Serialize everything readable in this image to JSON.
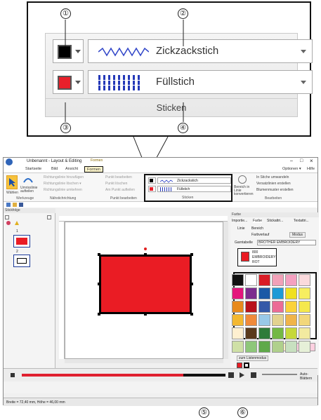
{
  "callouts": {
    "c1": "①",
    "c2": "②",
    "c3": "③",
    "c4": "④",
    "c5": "⑤",
    "c6": "⑥"
  },
  "zoom": {
    "row1": {
      "stitch": "Zickzackstich",
      "color": "#000000"
    },
    "row2": {
      "stitch": "Füllstich",
      "color": "#e8202a"
    },
    "group_label": "Sticken"
  },
  "window": {
    "title": "Unbenannt - Layout & Editing",
    "context_tab": "Formen",
    "controls": {
      "min": "–",
      "max": "□",
      "close": "×"
    }
  },
  "tabs": [
    "Startseite",
    "Bild",
    "Ansicht",
    "Formen"
  ],
  "tabs_right": {
    "options": "Optionen ▾",
    "help": "Hilfe"
  },
  "ribbon": {
    "select": "Wählen",
    "outlines": "Umrisslinie aufteilen",
    "tools_label": "Werkzeuge",
    "stitch_dir_items": [
      "Richtungslinie hinzufügen",
      "Richtungslinie löschen ▾",
      "Richtungslinie umkehren"
    ],
    "stitch_dir_label": "Nähstichrichtung",
    "point_items": [
      "Punkt bearbeiten",
      "Punkt löschen",
      "Am Punkt aufteilen"
    ],
    "point_label": "Punkt bearbeiten",
    "embroider_row1": "Zickzackstich",
    "embroider_row2": "Füllstich",
    "embroider_label": "Sticken",
    "convert": "Bereich in Linie konvertieren",
    "edit_items": [
      "In Stiche umwandeln",
      "Versatzlinien erstellen",
      "Blumenmuster erstellen"
    ],
    "edit_label": "Bearbeiten"
  },
  "left_pane": {
    "title": "Stickfolge",
    "items": [
      "1",
      "2"
    ]
  },
  "right_pane": {
    "title": "Farbe",
    "tabs": [
      "Importie...",
      "Farbe",
      "Stickattri...",
      "Textattri..."
    ],
    "line": "Linie",
    "area": "Bereich",
    "gradient": "Farbverlauf",
    "mode_button": "Modus",
    "table_label": "Garntabelle",
    "table_value": "BROTHER EMBROIDERY",
    "selected_color": {
      "code": "800",
      "name": "EMBROIDERY",
      "color_name": "ROT"
    },
    "user_list": "zum Listenmodus"
  },
  "status": {
    "size": "Breite = 72,40 mm, Höhe = 46,00 mm",
    "auto_scroll": "Auto-Blättern"
  },
  "palette": [
    "#111111",
    "#ffffff",
    "#d91c25",
    "#f2a1b8",
    "#f4a0c0",
    "#fadadd",
    "#e4157c",
    "#7c2c8e",
    "#1b59a6",
    "#1f9ad6",
    "#f0e020",
    "#f7ee60",
    "#e88a1d",
    "#b9121b",
    "#3559a8",
    "#ec6c96",
    "#fbd23a",
    "#f5e84c",
    "#f3b830",
    "#f08a3a",
    "#99c9e8",
    "#e3d28f",
    "#f0b44a",
    "#f2d77a",
    "#fff0d0",
    "#5a3a1c",
    "#2e7c3a",
    "#74b844",
    "#c6d83a",
    "#f2eaa0",
    "#cfe0a6",
    "#8ec77a",
    "#5fa94a",
    "#b0d08c",
    "#c8e0c0",
    "#e6f0d8"
  ],
  "design_colors": {
    "fill": "#ea1c24",
    "outline": "#000000"
  }
}
